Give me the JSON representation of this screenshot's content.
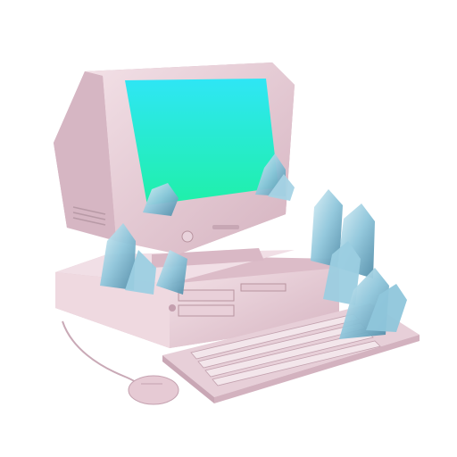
{
  "scene": {
    "background": "#ffffff",
    "subject": "retro-desktop-computer-with-crystals"
  },
  "colors": {
    "case_light": "#efd9e0",
    "case_mid": "#dcbcc8",
    "case_dark": "#c49fae",
    "case_shadow": "#a88593",
    "screen_top": "#2fe6f5",
    "screen_bottom": "#1ff0a8",
    "crystal_light": "#cfeaf3",
    "crystal_mid": "#8fc6db",
    "crystal_dark": "#4f8aa6",
    "cable": "#c9a9b6"
  },
  "icons": {
    "power_button": "circle-button",
    "crystals": "quartz-crystal-cluster"
  }
}
